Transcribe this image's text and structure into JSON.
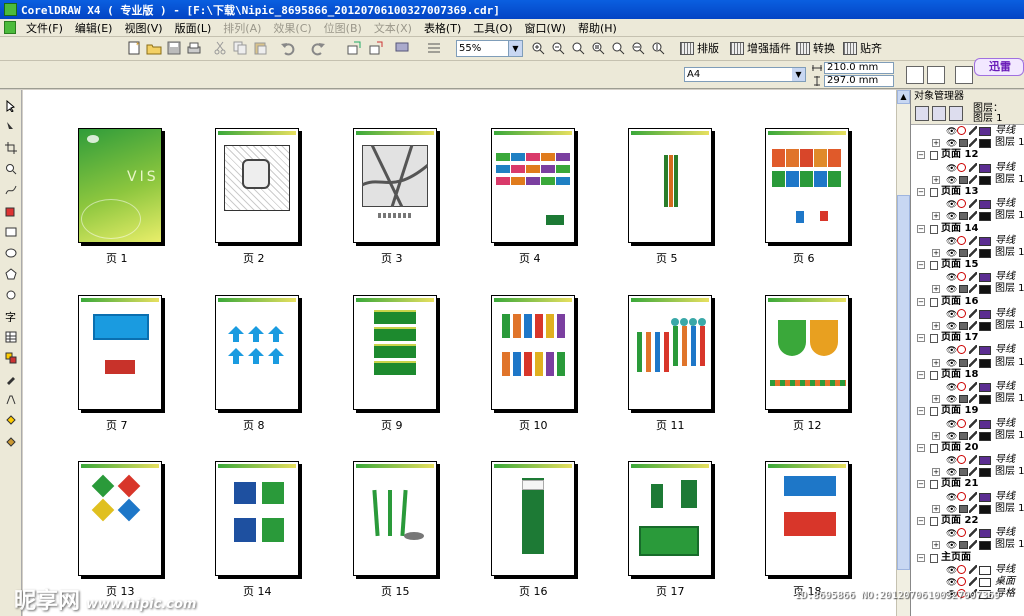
{
  "window": {
    "title": "CorelDRAW X4 ( 专业版 ) - [F:\\下载\\Nipic_8695866_20120706100327007369.cdr]"
  },
  "menu": [
    {
      "label": "文件(F)",
      "enabled": true
    },
    {
      "label": "编辑(E)",
      "enabled": true
    },
    {
      "label": "视图(V)",
      "enabled": true
    },
    {
      "label": "版面(L)",
      "enabled": true
    },
    {
      "label": "排列(A)",
      "enabled": false
    },
    {
      "label": "效果(C)",
      "enabled": false
    },
    {
      "label": "位图(B)",
      "enabled": false
    },
    {
      "label": "文本(X)",
      "enabled": false
    },
    {
      "label": "表格(T)",
      "enabled": true
    },
    {
      "label": "工具(O)",
      "enabled": true
    },
    {
      "label": "窗口(W)",
      "enabled": true
    },
    {
      "label": "帮助(H)",
      "enabled": true
    }
  ],
  "toolbar": {
    "zoom": "55%",
    "plugins": [
      "排版",
      "增强插件",
      "转换",
      "贴齐"
    ]
  },
  "property_bar": {
    "paper_size": "A4",
    "width": "210.0 mm",
    "height": "297.0 mm",
    "banner": "迅雷"
  },
  "pages": [
    {
      "label": "页 1"
    },
    {
      "label": "页 2"
    },
    {
      "label": "页 3"
    },
    {
      "label": "页 4"
    },
    {
      "label": "页 5"
    },
    {
      "label": "页 6"
    },
    {
      "label": "页 7"
    },
    {
      "label": "页 8"
    },
    {
      "label": "页 9"
    },
    {
      "label": "页 10"
    },
    {
      "label": "页 11"
    },
    {
      "label": "页 12"
    },
    {
      "label": "页 13"
    },
    {
      "label": "页 14"
    },
    {
      "label": "页 15"
    },
    {
      "label": "页 16"
    },
    {
      "label": "页 17"
    },
    {
      "label": "页 18"
    }
  ],
  "object_manager": {
    "title": "对象管理器",
    "info_line1": "图层：",
    "info_line2": "图层 1",
    "guide_layer": "导线",
    "layer_name": "图层 1",
    "page_prefix": "页面",
    "page_numbers": [
      "12",
      "13",
      "14",
      "15",
      "16",
      "17",
      "18",
      "19",
      "20",
      "21",
      "22"
    ],
    "master_page": "主页面",
    "master_children": [
      "导线",
      "桌面",
      "导格"
    ],
    "colors": {
      "guide_swatch": "#5b2d91",
      "layer_swatch": "#111111"
    }
  },
  "watermark": {
    "text": "昵享网",
    "url": "www.nipic.com",
    "id_text": "ID:8695866 NO:20120706100327007369"
  }
}
